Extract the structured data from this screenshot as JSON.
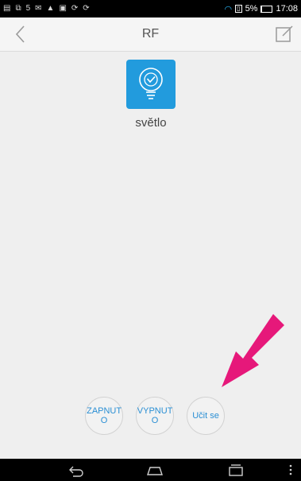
{
  "status_bar": {
    "left_icons": [
      "notification-icon",
      "screenshot-icon",
      "5",
      "mail-icon",
      "warning-icon",
      "message-icon",
      "sync-icon",
      "sync-icon"
    ],
    "number_indicator": "5",
    "battery_percent_text": "5%",
    "battery_level": 0.05,
    "time": "17:08",
    "wifi_color": "#29b6f6"
  },
  "header": {
    "title": "RF",
    "back_icon": "chevron-left-icon",
    "edit_icon": "edit-icon"
  },
  "device": {
    "label": "světlo",
    "icon": "lightbulb-icon",
    "tile_color": "#229bdd"
  },
  "controls": {
    "on_label": "ZAPNUT O",
    "off_label": "VYPNUT O",
    "learn_label": "Učit se",
    "text_color": "#2a8fd4"
  },
  "annotation": {
    "arrow_color": "#e6187a"
  },
  "navbar": {
    "icons": [
      "back-icon",
      "home-icon",
      "recents-icon",
      "menu-icon"
    ]
  }
}
